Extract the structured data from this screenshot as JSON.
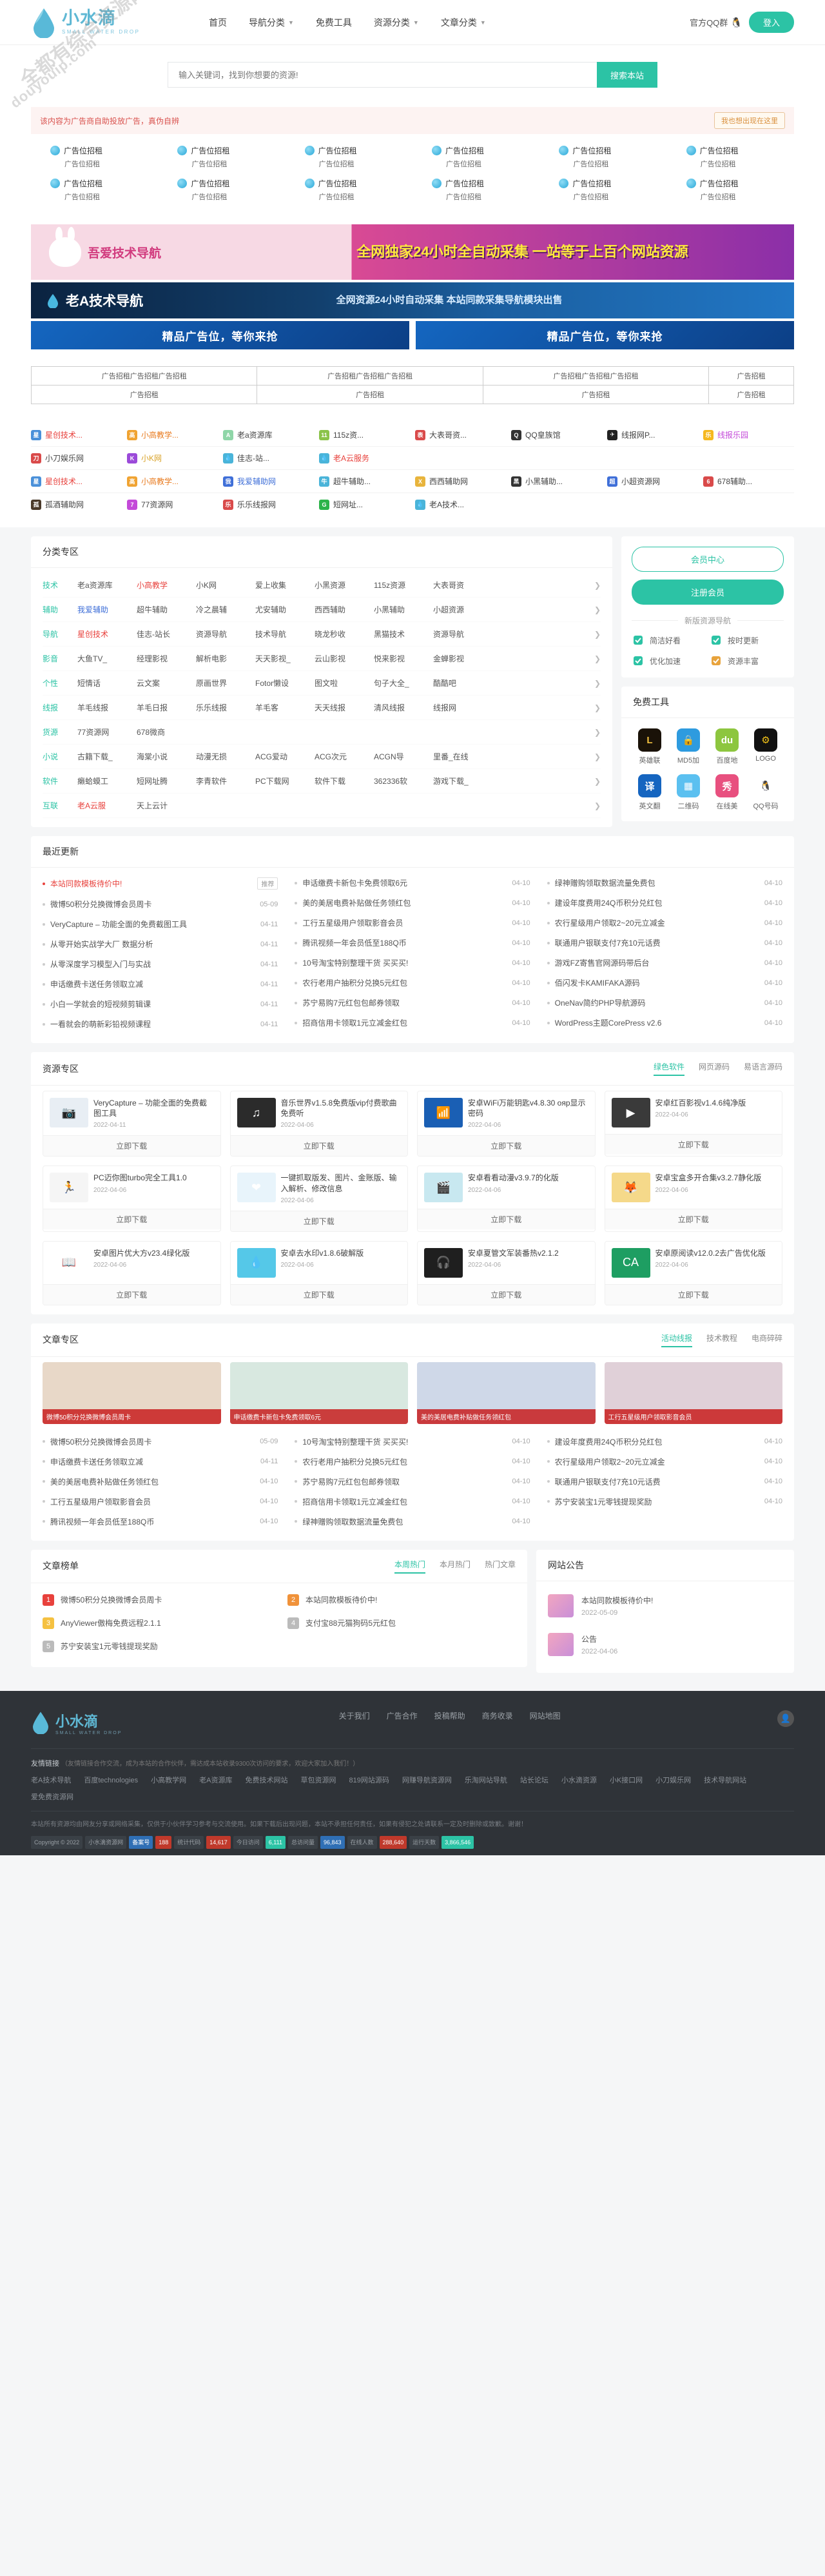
{
  "watermark": {
    "line1": "全都有综合资源网",
    "line2": "douyouip.com"
  },
  "header": {
    "logo_cn": "小水滴",
    "logo_en": "SMALL WATER DROP",
    "nav": [
      {
        "label": "首页",
        "caret": false
      },
      {
        "label": "导航分类",
        "caret": true
      },
      {
        "label": "免费工具",
        "caret": false
      },
      {
        "label": "资源分类",
        "caret": true
      },
      {
        "label": "文章分类",
        "caret": true
      }
    ],
    "qq_group": "官方QQ群",
    "login": "登入"
  },
  "search": {
    "placeholder": "输入关键词，找到你想要的资源!",
    "button": "搜索本站"
  },
  "ad_notice": {
    "text": "该内容为广告商自助投放广告，真伪自辨",
    "button": "我也想出现在这里"
  },
  "ad_cells": [
    {
      "l1": "广告位招租",
      "l2": "广告位招租"
    },
    {
      "l1": "广告位招租",
      "l2": "广告位招租"
    },
    {
      "l1": "广告位招租",
      "l2": "广告位招租"
    },
    {
      "l1": "广告位招租",
      "l2": "广告位招租"
    },
    {
      "l1": "广告位招租",
      "l2": "广告位招租"
    },
    {
      "l1": "广告位招租",
      "l2": "广告位招租"
    },
    {
      "l1": "广告位招租",
      "l2": "广告位招租"
    },
    {
      "l1": "广告位招租",
      "l2": "广告位招租"
    },
    {
      "l1": "广告位招租",
      "l2": "广告位招租"
    },
    {
      "l1": "广告位招租",
      "l2": "广告位招租"
    },
    {
      "l1": "广告位招租",
      "l2": "广告位招租"
    },
    {
      "l1": "广告位招租",
      "l2": "广告位招租"
    }
  ],
  "banners": {
    "rabbit_left": "吾爱技术导航",
    "rabbit_right": "全网独家24小时全自动采集 一站等于上百个网站资源",
    "tech_left": "老A技术导航",
    "tech_right": "全网资源24小时自动采集 本站同款采集导航模块出售",
    "blue_left": "精品广告位，等你来抢",
    "blue_right": "精品广告位，等你来抢"
  },
  "ad_table": {
    "row1": [
      "广告招租广告招租广告招租",
      "广告招租广告招租广告招租",
      "广告招租广告招租广告招租",
      "广告招租"
    ],
    "row2": [
      "广告招租",
      "广告招租",
      "广告招租",
      "广告招租"
    ]
  },
  "tag_rows": [
    [
      {
        "label": "星创技术...",
        "color": "#e8413c",
        "ic": "星",
        "bg": "#4a90d9"
      },
      {
        "label": "小高教学...",
        "color": "#e87a1e",
        "ic": "高",
        "bg": "#f0a332"
      },
      {
        "label": "老a资源库",
        "color": "#444",
        "ic": "A",
        "bg": "#8fd6a8"
      },
      {
        "label": "115z资...",
        "color": "#444",
        "ic": "11",
        "bg": "#8bc34a"
      },
      {
        "label": "大表哥资...",
        "color": "#444",
        "ic": "表",
        "bg": "#d94a4a"
      },
      {
        "label": "QQ皇族馆",
        "color": "#444",
        "ic": "Q",
        "bg": "#333"
      },
      {
        "label": "线报网P...",
        "color": "#444",
        "ic": "✈",
        "bg": "#222"
      },
      {
        "label": "线报乐园",
        "color": "#c44ad9",
        "ic": "乐",
        "bg": "#f5b820"
      }
    ],
    [
      {
        "label": "小刀娱乐网",
        "color": "#444",
        "ic": "刀",
        "bg": "#d94a4a"
      },
      {
        "label": "小K网",
        "color": "#d9a227",
        "ic": "K",
        "bg": "#9b4ad9"
      },
      {
        "label": "佳志-站...",
        "color": "#444",
        "ic": "💧",
        "bg": "#4ab4d9"
      },
      {
        "label": "老A云服务",
        "color": "#e8413c",
        "ic": "💧",
        "bg": "#4ab4d9"
      }
    ],
    [
      {
        "label": "星创技术...",
        "color": "#e8413c",
        "ic": "星",
        "bg": "#4a90d9"
      },
      {
        "label": "小高教学...",
        "color": "#e87a1e",
        "ic": "高",
        "bg": "#f0a332"
      },
      {
        "label": "我爱辅助网",
        "color": "#3f6fd8",
        "ic": "我",
        "bg": "#3f6fd8"
      },
      {
        "label": "超牛辅助...",
        "color": "#444",
        "ic": "牛",
        "bg": "#4ab4d9"
      },
      {
        "label": "西西辅助网",
        "color": "#444",
        "ic": "X",
        "bg": "#e8b43c"
      },
      {
        "label": "小黑辅助...",
        "color": "#444",
        "ic": "黑",
        "bg": "#333"
      },
      {
        "label": "小超资源网",
        "color": "#444",
        "ic": "超",
        "bg": "#3f6fd8"
      },
      {
        "label": "678辅助...",
        "color": "#444",
        "ic": "6",
        "bg": "#d94a4a"
      }
    ],
    [
      {
        "label": "孤酒辅助网",
        "color": "#444",
        "ic": "孤",
        "bg": "#4a3a2a"
      },
      {
        "label": "77资源网",
        "color": "#444",
        "ic": "7",
        "bg": "#c44ad9"
      },
      {
        "label": "乐乐线报网",
        "color": "#444",
        "ic": "乐",
        "bg": "#d94a4a"
      },
      {
        "label": "短网址...",
        "color": "#444",
        "ic": "G",
        "bg": "#2cb34a"
      },
      {
        "label": "老A技术...",
        "color": "#444",
        "ic": "💧",
        "bg": "#4ab4d9"
      }
    ]
  ],
  "category_zone": {
    "title": "分类专区",
    "rows": [
      {
        "name": "技术",
        "links": [
          {
            "t": "老a资源库",
            "c": ""
          },
          {
            "t": "小高教学",
            "c": "red"
          },
          {
            "t": "小K网",
            "c": ""
          },
          {
            "t": "爱上收集",
            "c": ""
          },
          {
            "t": "小黑资源",
            "c": ""
          },
          {
            "t": "115z资源",
            "c": ""
          },
          {
            "t": "大表哥资",
            "c": ""
          }
        ]
      },
      {
        "name": "辅助",
        "links": [
          {
            "t": "我爱辅助",
            "c": "blue"
          },
          {
            "t": "超牛辅助",
            "c": ""
          },
          {
            "t": "冷之晨辅",
            "c": ""
          },
          {
            "t": "尤安辅助",
            "c": ""
          },
          {
            "t": "西西辅助",
            "c": ""
          },
          {
            "t": "小黑辅助",
            "c": ""
          },
          {
            "t": "小超资源",
            "c": ""
          }
        ]
      },
      {
        "name": "导航",
        "links": [
          {
            "t": "星创技术",
            "c": "red"
          },
          {
            "t": "佳志-站长",
            "c": ""
          },
          {
            "t": "资源导航",
            "c": ""
          },
          {
            "t": "技术导航",
            "c": ""
          },
          {
            "t": "晓龙秒收",
            "c": ""
          },
          {
            "t": "黑猫技术",
            "c": ""
          },
          {
            "t": "资源导航",
            "c": ""
          }
        ]
      },
      {
        "name": "影音",
        "links": [
          {
            "t": "大鱼TV_",
            "c": ""
          },
          {
            "t": "经理影视",
            "c": ""
          },
          {
            "t": "解析电影",
            "c": ""
          },
          {
            "t": "天天影视_",
            "c": ""
          },
          {
            "t": "云山影视",
            "c": ""
          },
          {
            "t": "悦来影视",
            "c": ""
          },
          {
            "t": "金蝉影视",
            "c": ""
          }
        ]
      },
      {
        "name": "个性",
        "links": [
          {
            "t": "短情话",
            "c": ""
          },
          {
            "t": "云文案",
            "c": ""
          },
          {
            "t": "原画世界",
            "c": ""
          },
          {
            "t": "Fotor懒设",
            "c": ""
          },
          {
            "t": "图文啦",
            "c": ""
          },
          {
            "t": "句子大全_",
            "c": ""
          },
          {
            "t": "酷酷吧",
            "c": ""
          }
        ]
      },
      {
        "name": "线报",
        "links": [
          {
            "t": "羊毛线报",
            "c": ""
          },
          {
            "t": "羊毛日报",
            "c": ""
          },
          {
            "t": "乐乐线报",
            "c": ""
          },
          {
            "t": "羊毛客",
            "c": ""
          },
          {
            "t": "天天线报",
            "c": ""
          },
          {
            "t": "清风线报",
            "c": ""
          },
          {
            "t": "线报网",
            "c": ""
          }
        ]
      },
      {
        "name": "货源",
        "links": [
          {
            "t": "77资源网",
            "c": ""
          },
          {
            "t": "678微商",
            "c": ""
          }
        ]
      },
      {
        "name": "小说",
        "links": [
          {
            "t": "古籍下载_",
            "c": ""
          },
          {
            "t": "海棠小说",
            "c": ""
          },
          {
            "t": "动漫无损",
            "c": ""
          },
          {
            "t": "ACG爱动",
            "c": ""
          },
          {
            "t": "ACG次元",
            "c": ""
          },
          {
            "t": "ACGN导",
            "c": ""
          },
          {
            "t": "里番_在线",
            "c": ""
          }
        ]
      },
      {
        "name": "软件",
        "links": [
          {
            "t": "癞蛤蟆工",
            "c": ""
          },
          {
            "t": "短网址腾",
            "c": ""
          },
          {
            "t": "李青软件",
            "c": ""
          },
          {
            "t": "PC下载网",
            "c": ""
          },
          {
            "t": "软件下载",
            "c": ""
          },
          {
            "t": "362336软",
            "c": ""
          },
          {
            "t": "游戏下载_",
            "c": ""
          }
        ]
      },
      {
        "name": "互联",
        "links": [
          {
            "t": "老A云服",
            "c": "red"
          },
          {
            "t": "天上云计",
            "c": ""
          }
        ]
      }
    ]
  },
  "sidebar": {
    "member_center": "会员中心",
    "register": "注册会员",
    "divider": "新版资源导航",
    "features": [
      {
        "label": "简洁好看",
        "icon": "clean-icon"
      },
      {
        "label": "按时更新",
        "icon": "update-icon"
      },
      {
        "label": "优化加速",
        "icon": "speed-icon"
      },
      {
        "label": "资源丰富",
        "icon": "rich-icon"
      }
    ],
    "tools_title": "免费工具",
    "tools": [
      {
        "label": "英雄联",
        "ic": "L",
        "bg": "#1a1208",
        "fg": "#f0c040"
      },
      {
        "label": "MD5加",
        "ic": "🔒",
        "bg": "#2e9bdf",
        "fg": "#fff"
      },
      {
        "label": "百度地",
        "ic": "du",
        "bg": "#8dc63f",
        "fg": "#fff"
      },
      {
        "label": "LOGO",
        "ic": "⚙",
        "bg": "#111",
        "fg": "#f5c518"
      },
      {
        "label": "英文翻",
        "ic": "译",
        "bg": "#1565c0",
        "fg": "#fff"
      },
      {
        "label": "二维码",
        "ic": "▦",
        "bg": "#5bc0f0",
        "fg": "#fff"
      },
      {
        "label": "在线美",
        "ic": "秀",
        "bg": "#e8507f",
        "fg": "#fff"
      },
      {
        "label": "QQ号码",
        "ic": "🐧",
        "bg": "#fff",
        "fg": "#333"
      }
    ]
  },
  "recent": {
    "title": "最近更新",
    "items": [
      {
        "t": "本站同款模板待价中!",
        "d": "推荐",
        "red": true,
        "badge": true
      },
      {
        "t": "微博50积分兑换微博会员周卡",
        "d": "05-09"
      },
      {
        "t": "VeryCapture – 功能全面的免费截图工具",
        "d": "04-11"
      },
      {
        "t": "从零开始实战学大厂 数据分析",
        "d": "04-11"
      },
      {
        "t": "从零深度学习模型入门与实战",
        "d": "04-11"
      },
      {
        "t": "申话缴费卡送任务领取立减",
        "d": "04-11"
      },
      {
        "t": "小白一学就会的短视频剪辑课",
        "d": "04-11"
      },
      {
        "t": "一看就会的萌新彩铅视频课程",
        "d": "04-11"
      },
      {
        "t": "申话缴费卡新包卡免费领取6元",
        "d": "04-10"
      },
      {
        "t": "美的美居电费补贴做任务领红包",
        "d": "04-10"
      },
      {
        "t": "工行五星级用户领取影音会员",
        "d": "04-10"
      },
      {
        "t": "腾讯视频一年会员低至188Q币",
        "d": "04-10"
      },
      {
        "t": "10号淘宝特别整理干货 买买买!",
        "d": "04-10"
      },
      {
        "t": "农行老用户抽积分兑换5元红包",
        "d": "04-10"
      },
      {
        "t": "苏宁易购7元红包包邮券领取",
        "d": "04-10"
      },
      {
        "t": "招商信用卡领取1元立减金红包",
        "d": "04-10"
      },
      {
        "t": "绿神赠购领取数据流量免费包",
        "d": "04-10"
      },
      {
        "t": "建设年度费用24Q币积分兑红包",
        "d": "04-10"
      },
      {
        "t": "农行星级用户领取2~20元立减金",
        "d": "04-10"
      },
      {
        "t": "联通用户银联支付7充10元话费",
        "d": "04-10"
      },
      {
        "t": "游戏FZ寄售官网源码带后台",
        "d": "04-10"
      },
      {
        "t": "佰闪发卡KAMIFAKA源码",
        "d": "04-10"
      },
      {
        "t": "OneNav简约PHP导航源码",
        "d": "04-10"
      },
      {
        "t": "WordPress主题CorePress v2.6",
        "d": "04-10"
      }
    ]
  },
  "resource_zone": {
    "title": "资源专区",
    "tabs": [
      {
        "label": "绿色软件",
        "active": true
      },
      {
        "label": "网页源码",
        "active": false
      },
      {
        "label": "易语言源码",
        "active": false
      }
    ],
    "download": "立即下载",
    "items": [
      {
        "title": "VeryCapture – 功能全面的免费截图工具",
        "date": "2022-04-11",
        "bg": "#e8eef4",
        "ic": "📷"
      },
      {
        "title": "音乐世界v1.5.8免费版vip付费歌曲免费听",
        "date": "2022-04-06",
        "bg": "#2b2b2b",
        "ic": "♫"
      },
      {
        "title": "安卓WiFi万能钥匙v4.8.30 ояр显示密码",
        "date": "2022-04-06",
        "bg": "#1a5fb4",
        "ic": "📶"
      },
      {
        "title": "安卓红百影视v1.4.6纯净版",
        "date": "2022-04-06",
        "bg": "#3a3a3a",
        "ic": "▶"
      },
      {
        "title": "PC迈你图turbo完全工具1.0",
        "date": "2022-04-06",
        "bg": "#f5f5f5",
        "ic": "🏃"
      },
      {
        "title": "一键抓取版发、图片、金账版、输入解析、修改信息",
        "date": "2022-04-06",
        "bg": "#e8f4fb",
        "ic": "❤"
      },
      {
        "title": "安卓看看动漫v3.9.7的化版",
        "date": "2022-04-06",
        "bg": "#c8e8f0",
        "ic": "🎬"
      },
      {
        "title": "安卓宝盒多开合集v3.2.7静化版",
        "date": "2022-04-06",
        "bg": "#f5d98a",
        "ic": "🦊"
      },
      {
        "title": "安卓图片优大方v23.4绿化版",
        "date": "2022-04-06",
        "bg": "#fff",
        "ic": "📖"
      },
      {
        "title": "安卓去水印v1.8.6破解版",
        "date": "2022-04-06",
        "bg": "#55c8e8",
        "ic": "💧"
      },
      {
        "title": "安卓夏管文军装番热v2.1.2",
        "date": "2022-04-06",
        "bg": "#1f1f1f",
        "ic": "🎧"
      },
      {
        "title": "安卓原阅读v12.0.2去广告优化版",
        "date": "2022-04-06",
        "bg": "#1e9e62",
        "ic": "CA"
      }
    ]
  },
  "article_zone": {
    "title": "文章专区",
    "tabs": [
      {
        "label": "活动线报",
        "active": true
      },
      {
        "label": "技术教程",
        "active": false
      },
      {
        "label": "电商碎碎",
        "active": false
      }
    ],
    "cards": [
      {
        "cap": "微博50积分兑换微博会员周卡",
        "bg": "#e8d8c8"
      },
      {
        "cap": "申话缴费卡新包卡免费领取6元",
        "bg": "#d8e8e0"
      },
      {
        "cap": "美的美居电费补贴做任务领红包",
        "bg": "#cfd8e8"
      },
      {
        "cap": "工行五星级用户领取影音会员",
        "bg": "#e0d0d8"
      }
    ],
    "list": [
      {
        "t": "微博50积分兑换微博会员周卡",
        "d": "05-09"
      },
      {
        "t": "申话缴费卡送任务领取立减",
        "d": "04-11"
      },
      {
        "t": "美的美居电费补贴做任务领红包",
        "d": "04-10"
      },
      {
        "t": "工行五星级用户领取影音会员",
        "d": "04-10"
      },
      {
        "t": "腾讯视频一年会员低至188Q币",
        "d": "04-10"
      },
      {
        "t": "10号淘宝特别整理干货 买买买!",
        "d": "04-10"
      },
      {
        "t": "农行老用户抽积分兑换5元红包",
        "d": "04-10"
      },
      {
        "t": "苏宁易购7元红包包邮券领取",
        "d": "04-10"
      },
      {
        "t": "招商信用卡领取1元立减金红包",
        "d": "04-10"
      },
      {
        "t": "绿神赠购领取数据流量免费包",
        "d": "04-10"
      },
      {
        "t": "建设年度费用24Q币积分兑红包",
        "d": "04-10"
      },
      {
        "t": "农行星级用户领取2~20元立减金",
        "d": "04-10"
      },
      {
        "t": "联通用户银联支付7充10元话费",
        "d": "04-10"
      },
      {
        "t": "苏宁安装宝1元零钱提现奖励",
        "d": "04-10"
      }
    ]
  },
  "bottom": {
    "rank_title": "文章榜单",
    "rank_tabs": [
      {
        "label": "本周热门",
        "active": true
      },
      {
        "label": "本月热门",
        "active": false
      },
      {
        "label": "热门文章",
        "active": false
      }
    ],
    "ranks": [
      {
        "no": "1",
        "t": "微博50积分兑换微博会员周卡",
        "cls": "n1"
      },
      {
        "no": "2",
        "t": "本站同款模板待价中!",
        "cls": "n2"
      },
      {
        "no": "3",
        "t": "AnyViewer傲梅免费远程2.1.1",
        "cls": "n3"
      },
      {
        "no": "4",
        "t": "支付宝88元猫狗码5元红包",
        "cls": "n4"
      },
      {
        "no": "5",
        "t": "苏宁安装宝1元零钱提现奖励",
        "cls": "n4"
      }
    ],
    "notice_title": "网站公告",
    "notices": [
      {
        "t": "本站同款模板待价中!",
        "d": "2022-05-09"
      },
      {
        "t": "公告",
        "d": "2022-04-06"
      }
    ]
  },
  "footer": {
    "logo_cn": "小水滴",
    "logo_en": "SMALL WATER DROP",
    "links": [
      "关于我们",
      "广告合作",
      "投稿帮助",
      "商务收录",
      "网站地图"
    ],
    "friend_title": "友情链接",
    "friend_note": "（友情链接合作交流，成为本站的合作伙伴，需达成本站收录9300次访问的要求，欢迎大家加入我们！）",
    "friend_links": [
      "老A技术导航",
      "百度technologies",
      "小高教学网",
      "老A资源库",
      "免费技术网站",
      "草包资源网",
      "819网站源码",
      "网赚导航资源网",
      "乐淘网站导航",
      "站长论坛",
      "小水滴资源",
      "小K接口网",
      "小刀娱乐网",
      "技术导航网站",
      "爱免费资源网"
    ],
    "note": "本站所有资源均由网友分享或网络采集，仅供于小伙伴学习参考与交流使用。如果下载后出现问题，本站不承担任何责任，如果有侵犯之处请联系一定及时删除或致歉。谢谢！",
    "stats": [
      {
        "t": "Copyright © 2022",
        "cls": ""
      },
      {
        "t": "小水滴资源网",
        "cls": ""
      },
      {
        "t": "备案号",
        "cls": "hl"
      },
      {
        "t": "188",
        "cls": "hl2"
      },
      {
        "t": "统计代码",
        "cls": ""
      },
      {
        "t": "14,617",
        "cls": "hl2"
      },
      {
        "t": "今日访问",
        "cls": ""
      },
      {
        "t": "6,111",
        "cls": "hl3"
      },
      {
        "t": "总访问量",
        "cls": ""
      },
      {
        "t": "96,843",
        "cls": "hl"
      },
      {
        "t": "在线人数",
        "cls": ""
      },
      {
        "t": "288,640",
        "cls": "hl2"
      },
      {
        "t": "运行天数",
        "cls": ""
      },
      {
        "t": "3,866,546",
        "cls": "hl3"
      }
    ]
  }
}
